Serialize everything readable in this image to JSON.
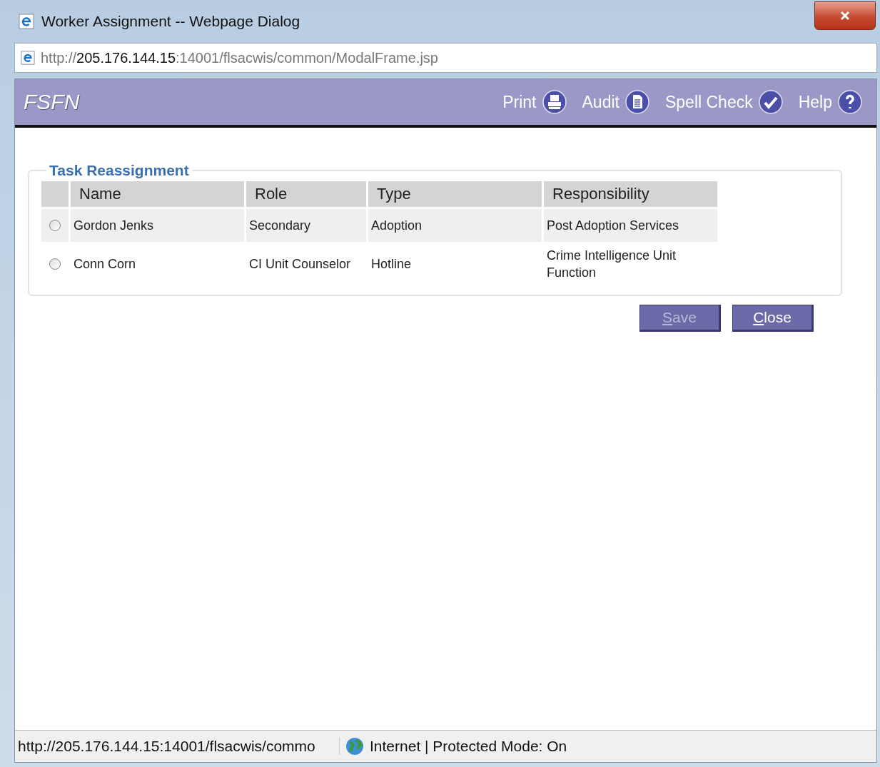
{
  "window": {
    "title": "Worker Assignment -- Webpage Dialog"
  },
  "address_bar": {
    "parts": [
      {
        "text": "http://",
        "emphasis": false
      },
      {
        "text": "205.176.144.15",
        "emphasis": true
      },
      {
        "text": ":14001/flsacwis/common/ModalFrame.jsp",
        "emphasis": false
      }
    ]
  },
  "header": {
    "brand": "FSFN",
    "actions": [
      {
        "label": "Print",
        "kind": "print"
      },
      {
        "label": "Audit",
        "kind": "audit"
      },
      {
        "label": "Spell Check",
        "kind": "spell"
      },
      {
        "label": "Help",
        "kind": "help"
      }
    ]
  },
  "panel": {
    "title": "Task Reassignment",
    "table": {
      "columns": [
        "Name",
        "Role",
        "Type",
        "Responsibility"
      ],
      "rows": [
        {
          "selected": false,
          "cells": [
            "Gordon Jenks",
            "Secondary",
            "Adoption",
            "Post Adoption Services"
          ]
        },
        {
          "selected": false,
          "cells": [
            "Conn Corn",
            "CI Unit Counselor",
            "Hotline",
            "Crime Intelligence Unit Function"
          ]
        }
      ]
    }
  },
  "buttons": [
    {
      "label": "Save",
      "disabled": true
    },
    {
      "label": "Close",
      "disabled": false
    }
  ],
  "status_bar": {
    "url": "http://205.176.144.15:14001/flsacwis/commo",
    "zone": "Internet | Protected Mode: On"
  }
}
